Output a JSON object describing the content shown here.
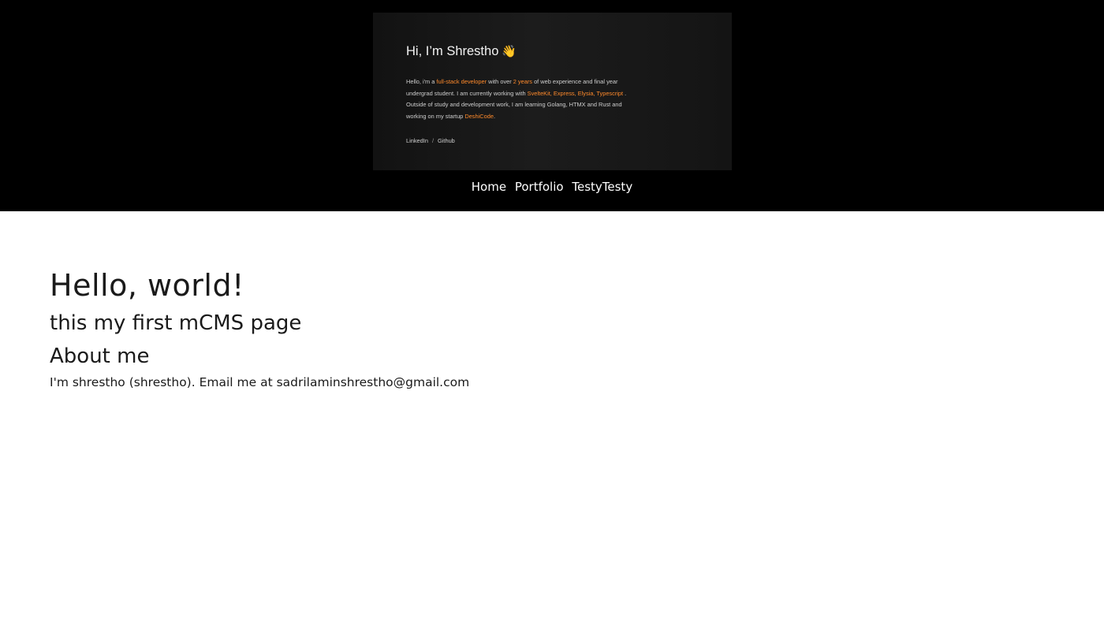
{
  "banner": {
    "greeting": "Hi, I’m Shrestho",
    "wave_icon": "👋",
    "body_parts": [
      {
        "text": "Hello, i'm a ",
        "highlight": false
      },
      {
        "text": "full-stack developer",
        "highlight": true
      },
      {
        "text": " with over ",
        "highlight": false
      },
      {
        "text": "2 years",
        "highlight": true
      },
      {
        "text": " of web experience and final year undergrad student. I am currently working with ",
        "highlight": false
      },
      {
        "text": "SvelteKit, Express, Elysia, Typescript",
        "highlight": true
      },
      {
        "text": " . Outside of study and development work, I am learning Golang, HTMX and Rust and working on my startup ",
        "highlight": false
      },
      {
        "text": "DeshiCode",
        "highlight": true
      },
      {
        "text": ".",
        "highlight": false
      }
    ],
    "links": [
      "LinkedIn",
      "Github"
    ],
    "link_separator": "/",
    "highlight_color": "#ff8a2b"
  },
  "nav": {
    "items": [
      "Home",
      "Portfolio",
      "TestyTesty"
    ]
  },
  "content": {
    "heading": "Hello, world!",
    "subheading": "this my first mCMS page",
    "about_heading": "About me",
    "about_text": "I'm shrestho (shrestho). Email me at sadrilaminshrestho@gmail.com"
  },
  "colors": {
    "header_bg": "#000000",
    "page_bg": "#ffffff",
    "text": "#1a1a1a"
  }
}
